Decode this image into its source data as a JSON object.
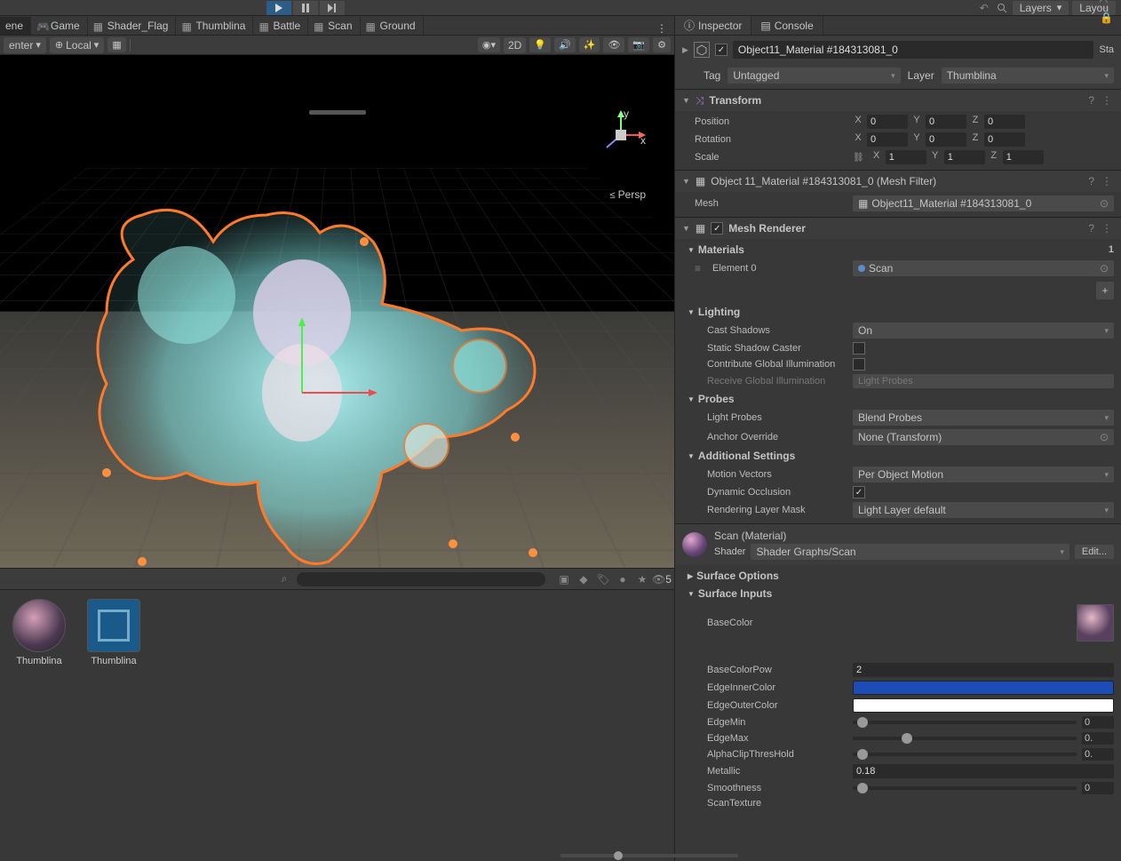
{
  "toolbar": {
    "layers_label": "Layers",
    "layout_label": "Layou"
  },
  "scene_tabs": [
    {
      "label": "ene",
      "icon": "scene",
      "active": true
    },
    {
      "label": "Game",
      "icon": "game"
    },
    {
      "label": "Shader_Flag",
      "icon": "shader"
    },
    {
      "label": "Thumblina",
      "icon": "shader"
    },
    {
      "label": "Battle",
      "icon": "shader"
    },
    {
      "label": "Scan",
      "icon": "shader"
    },
    {
      "label": "Ground",
      "icon": "shader"
    }
  ],
  "scene_toolbar": {
    "tool1": "enter",
    "pivot": "Local",
    "grid_on": true,
    "mode": "2D",
    "persp": "Persp"
  },
  "project": {
    "assets": [
      {
        "name": "Thumblina",
        "type": "material"
      },
      {
        "name": "Thumblina",
        "type": "prefab"
      }
    ],
    "vis_count": "5"
  },
  "inspector": {
    "tabs": [
      {
        "label": "Inspector",
        "active": true
      },
      {
        "label": "Console"
      }
    ],
    "object_name": "Object11_Material #184313081_0",
    "enabled": true,
    "static_label": "Sta",
    "tag_label": "Tag",
    "tag_value": "Untagged",
    "layer_label": "Layer",
    "layer_value": "Thumblina",
    "transform": {
      "title": "Transform",
      "position": {
        "label": "Position",
        "x": "0",
        "y": "0",
        "z": "0"
      },
      "rotation": {
        "label": "Rotation",
        "x": "0",
        "y": "0",
        "z": "0"
      },
      "scale": {
        "label": "Scale",
        "x": "1",
        "y": "1",
        "z": "1"
      }
    },
    "mesh_filter": {
      "title": "Object 11_Material #184313081_0 (Mesh Filter)",
      "mesh_label": "Mesh",
      "mesh_value": "Object11_Material #184313081_0"
    },
    "mesh_renderer": {
      "title": "Mesh Renderer",
      "materials_label": "Materials",
      "materials_count": "1",
      "element0_label": "Element 0",
      "element0_value": "Scan",
      "lighting_label": "Lighting",
      "cast_shadows_label": "Cast Shadows",
      "cast_shadows_value": "On",
      "static_shadow_label": "Static Shadow Caster",
      "static_shadow_value": false,
      "gi_label": "Contribute Global Illumination",
      "gi_value": false,
      "receive_gi_label": "Receive Global Illumination",
      "receive_gi_value": "Light Probes",
      "probes_label": "Probes",
      "light_probes_label": "Light Probes",
      "light_probes_value": "Blend Probes",
      "anchor_label": "Anchor Override",
      "anchor_value": "None (Transform)",
      "additional_label": "Additional Settings",
      "motion_label": "Motion Vectors",
      "motion_value": "Per Object Motion",
      "occlusion_label": "Dynamic Occlusion",
      "occlusion_value": true,
      "layer_mask_label": "Rendering Layer Mask",
      "layer_mask_value": "Light Layer default"
    },
    "material": {
      "name": "Scan  (Material)",
      "shader_label": "Shader",
      "shader_value": "Shader Graphs/Scan",
      "edit_label": "Edit...",
      "surface_options": "Surface Options",
      "surface_inputs": "Surface Inputs",
      "basecolor_label": "BaseColor",
      "basecolorpow_label": "BaseColorPow",
      "basecolorpow_value": "2",
      "edgeinner_label": "EdgeInnerColor",
      "edgeinner_color": "#1a4db8",
      "edgeouter_label": "EdgeOuterColor",
      "edgeouter_color": "#ffffff",
      "edgemin_label": "EdgeMin",
      "edgemin_pos": 0.02,
      "edgemin_val": "0",
      "edgemax_label": "EdgeMax",
      "edgemax_pos": 0.22,
      "edgemax_val": "0.",
      "alphaclip_label": "AlphaClipThresHold",
      "alphaclip_pos": 0.02,
      "alphaclip_val": "0.",
      "metallic_label": "Metallic",
      "metallic_value": "0.18",
      "smoothness_label": "Smoothness",
      "smoothness_pos": 0.02,
      "smoothness_val": "0",
      "scantex_label": "ScanTexture"
    }
  }
}
